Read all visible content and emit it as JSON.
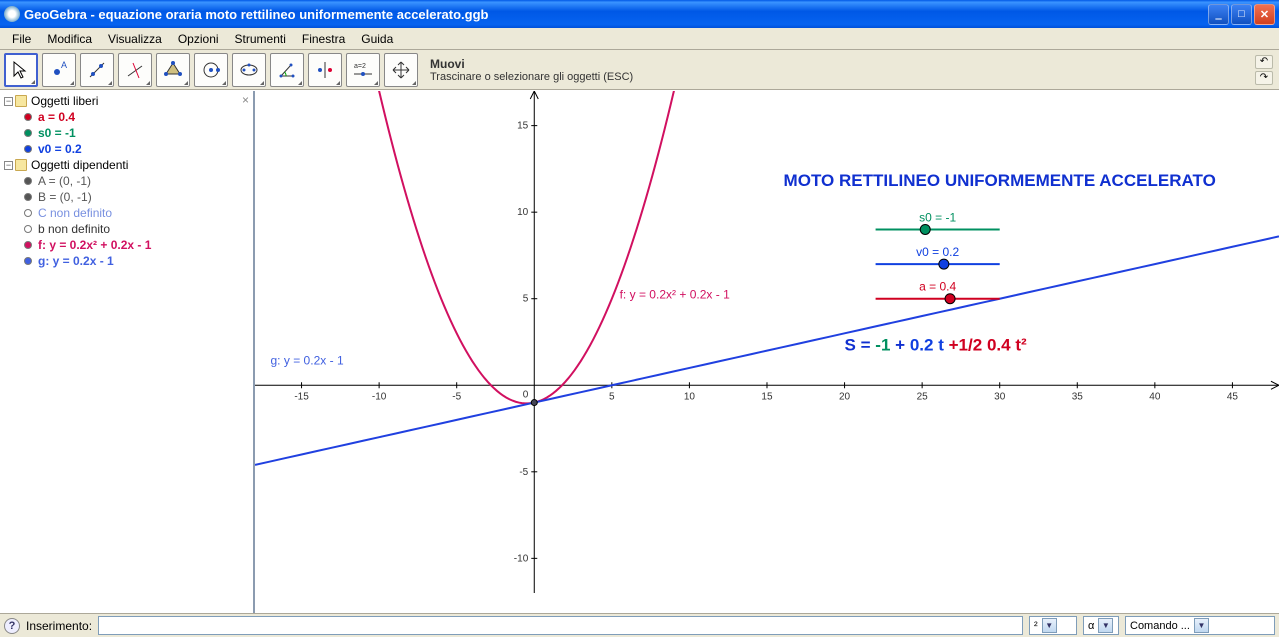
{
  "window": {
    "title": "GeoGebra - equazione oraria moto rettilineo uniformemente accelerato.ggb"
  },
  "menu": [
    "File",
    "Modifica",
    "Visualizza",
    "Opzioni",
    "Strumenti",
    "Finestra",
    "Guida"
  ],
  "tool_help": {
    "title": "Muovi",
    "desc": "Trascinare o selezionare gli oggetti (ESC)"
  },
  "algebra": {
    "close": "×",
    "free": {
      "label": "Oggetti liberi",
      "items": [
        {
          "text": "a = 0.4",
          "color": "#d00020",
          "filled": true
        },
        {
          "text": "s0 = -1",
          "color": "#009060",
          "filled": true
        },
        {
          "text": "v0 = 0.2",
          "color": "#1040e0",
          "filled": true
        }
      ]
    },
    "dep": {
      "label": "Oggetti dipendenti",
      "items": [
        {
          "text": "A = (0, -1)",
          "color": "#555",
          "filled": true
        },
        {
          "text": "B = (0, -1)",
          "color": "#555",
          "filled": true
        },
        {
          "text": "C non definito",
          "color": "#7890e0",
          "filled": false
        },
        {
          "text": "b non definito",
          "color": "#333",
          "filled": false
        },
        {
          "text": "f: y = 0.2x² + 0.2x - 1",
          "color": "#d11060",
          "filled": true
        },
        {
          "text": "g: y = 0.2x - 1",
          "color": "#4060e0",
          "filled": true
        }
      ]
    }
  },
  "graphics": {
    "title_text": "MOTO RETTILINEO UNIFORMEMENTE ACCELERATO",
    "f_label": "f: y = 0.2x² + 0.2x - 1",
    "g_label": "g: y = 0.2x - 1",
    "sliders": {
      "s0": {
        "label": "s0 = -1"
      },
      "v0": {
        "label": "v0 = 0.2"
      },
      "a": {
        "label": "a = 0.4"
      }
    },
    "formula": {
      "S": "S = ",
      "neg1": "-1 ",
      "plus": "+ ",
      "v0t": "0.2  t  ",
      "half": "+1/2  ",
      "at2": "0.4 t²"
    }
  },
  "input": {
    "label": "Inserimento:",
    "sel1": "²",
    "sel2": "α",
    "sel3": "Comando ..."
  },
  "chart_data": {
    "type": "line",
    "title": "MOTO RETTILINEO UNIFORMEMENTE ACCELERATO",
    "xlim": [
      -18,
      48
    ],
    "ylim": [
      -12,
      17
    ],
    "x_ticks": [
      -15,
      -10,
      -5,
      0,
      5,
      10,
      15,
      20,
      25,
      30,
      35,
      40,
      45
    ],
    "y_ticks": [
      -10,
      -5,
      0,
      5,
      10,
      15
    ],
    "parameters": {
      "a": 0.4,
      "v0": 0.2,
      "s0": -1
    },
    "series": [
      {
        "name": "f: y = 0.2x² + 0.2x - 1",
        "type": "parabola",
        "coeffs": {
          "a": 0.2,
          "b": 0.2,
          "c": -1
        },
        "color": "#d11060"
      },
      {
        "name": "g: y = 0.2x - 1",
        "type": "line",
        "slope": 0.2,
        "intercept": -1,
        "color": "#2040e0"
      }
    ],
    "points": [
      {
        "name": "A",
        "x": 0,
        "y": -1
      },
      {
        "name": "B",
        "x": 0,
        "y": -1
      }
    ],
    "equation_text": "S = -1 + 0.2 t + 1/2 · 0.4 t²"
  }
}
